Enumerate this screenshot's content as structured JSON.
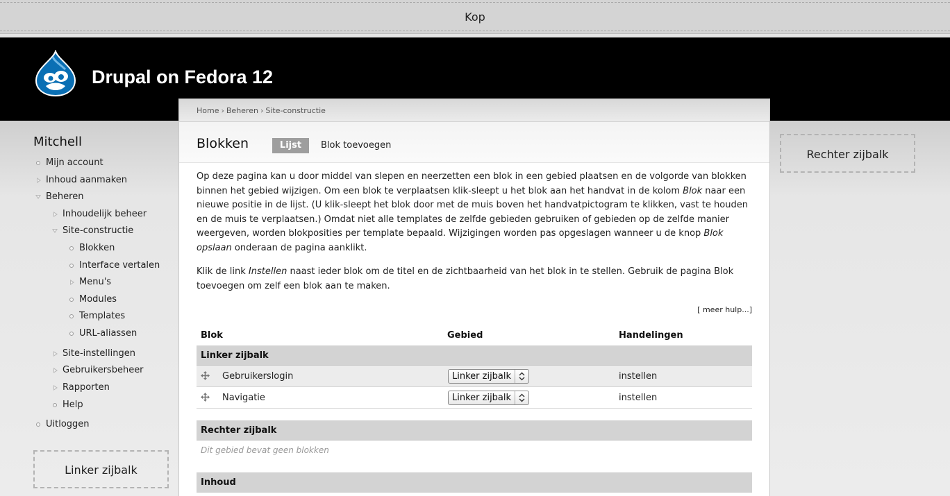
{
  "kop": {
    "label": "Kop"
  },
  "header": {
    "site_name": "Drupal on Fedora 12",
    "logo_icon": "drupal-drop-icon"
  },
  "sidebar_left": {
    "user_name": "Mitchell",
    "items": [
      {
        "label": "Mijn account",
        "state": "leaf"
      },
      {
        "label": "Inhoud aanmaken",
        "state": "collapsed"
      },
      {
        "label": "Beheren",
        "state": "expanded"
      },
      {
        "label": "Inhoudelijk beheer",
        "state": "collapsed"
      },
      {
        "label": "Site-constructie",
        "state": "expanded"
      },
      {
        "label": "Blokken",
        "state": "leaf"
      },
      {
        "label": "Interface vertalen",
        "state": "leaf"
      },
      {
        "label": "Menu's",
        "state": "collapsed"
      },
      {
        "label": "Modules",
        "state": "leaf"
      },
      {
        "label": "Templates",
        "state": "leaf"
      },
      {
        "label": "URL-aliassen",
        "state": "leaf"
      },
      {
        "label": "Site-instellingen",
        "state": "collapsed"
      },
      {
        "label": "Gebruikersbeheer",
        "state": "collapsed"
      },
      {
        "label": "Rapporten",
        "state": "collapsed"
      },
      {
        "label": "Help",
        "state": "leaf"
      },
      {
        "label": "Uitloggen",
        "state": "leaf"
      }
    ],
    "region_label": "Linker zijbalk"
  },
  "sidebar_right": {
    "region_label": "Rechter zijbalk"
  },
  "breadcrumb": [
    "Home",
    "Beheren",
    "Site-constructie"
  ],
  "breadcrumb_separator": "›",
  "page": {
    "title": "Blokken",
    "tabs": [
      {
        "label": "Lijst",
        "active": true
      },
      {
        "label": "Blok toevoegen",
        "active": false
      }
    ],
    "help": {
      "p1_a": "Op deze pagina kan u door middel van slepen en neerzetten een blok in een gebied plaatsen en de volgorde van blokken binnen het gebied wijzigen. Om een blok te verplaatsen klik-sleept u het blok aan het handvat in de kolom ",
      "p1_em1": "Blok",
      "p1_b": " naar een nieuwe positie in de lijst. (U klik-sleept het blok door met de muis boven het handvatpictogram te klikken, vast te houden en de muis te verplaatsen.) Omdat niet alle templates de zelfde gebieden gebruiken of gebieden op de zelfde manier weergeven, worden blokposities per template bepaald. Wijzigingen worden pas opgeslagen wanneer u de knop ",
      "p1_em2": "Blok opslaan",
      "p1_c": " onderaan de pagina aanklikt.",
      "p2_a": "Klik de link ",
      "p2_em": "Instellen",
      "p2_b": " naast ieder blok om de titel en de zichtbaarheid van het blok in te stellen. Gebruik de pagina Blok toevoegen om zelf een blok aan te maken."
    },
    "more_help": "[ meer hulp...]"
  },
  "table": {
    "headers": {
      "block": "Blok",
      "region": "Gebied",
      "operations": "Handelingen"
    },
    "regions": [
      {
        "name": "Linker zijbalk",
        "blocks": [
          {
            "name": "Gebruikerslogin",
            "region": "Linker zijbalk",
            "op": "instellen"
          },
          {
            "name": "Navigatie",
            "region": "Linker zijbalk",
            "op": "instellen"
          }
        ]
      },
      {
        "name": "Rechter zijbalk",
        "empty_message": "Dit gebied bevat geen blokken"
      },
      {
        "name": "Inhoud"
      }
    ]
  }
}
